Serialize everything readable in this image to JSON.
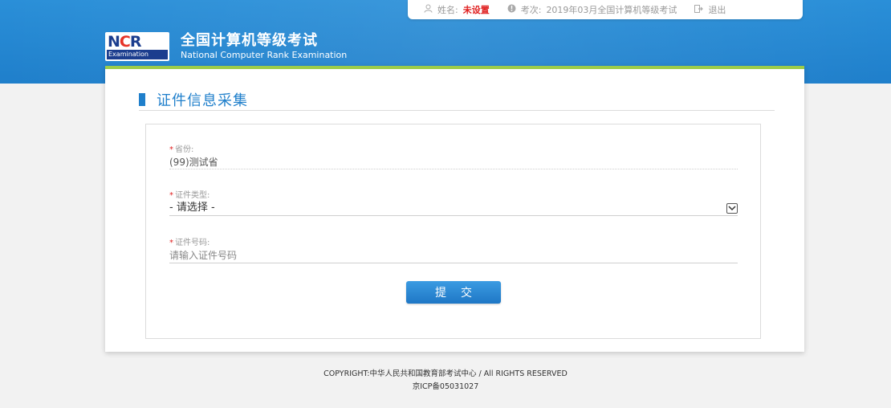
{
  "userbar": {
    "name_label": "姓名:",
    "name_value": "未设置",
    "exam_label": "考次:",
    "exam_value": "2019年03月全国计算机等级考试",
    "logout_label": "退出"
  },
  "brand": {
    "logo_text_main": "NCR",
    "logo_text_sub": "Examination",
    "title_cn": "全国计算机等级考试",
    "title_en": "National Computer Rank Examination"
  },
  "section": {
    "title": "证件信息采集"
  },
  "form": {
    "province": {
      "label": "省份:",
      "value": "(99)测试省"
    },
    "id_type": {
      "label": "证件类型:",
      "value": "- 请选择 -"
    },
    "id_number": {
      "label": "证件号码:",
      "placeholder": "请输入证件号码"
    },
    "submit_label": "提交"
  },
  "footer": {
    "copyright": "COPYRIGHT:中华人民共和国教育部考试中心 / All RIGHTS RESERVED",
    "icp": "京ICP备05031027"
  },
  "colors": {
    "header_blue": "#1f7fcb",
    "accent_green": "#9ccc4a",
    "required_red": "#e02020"
  }
}
